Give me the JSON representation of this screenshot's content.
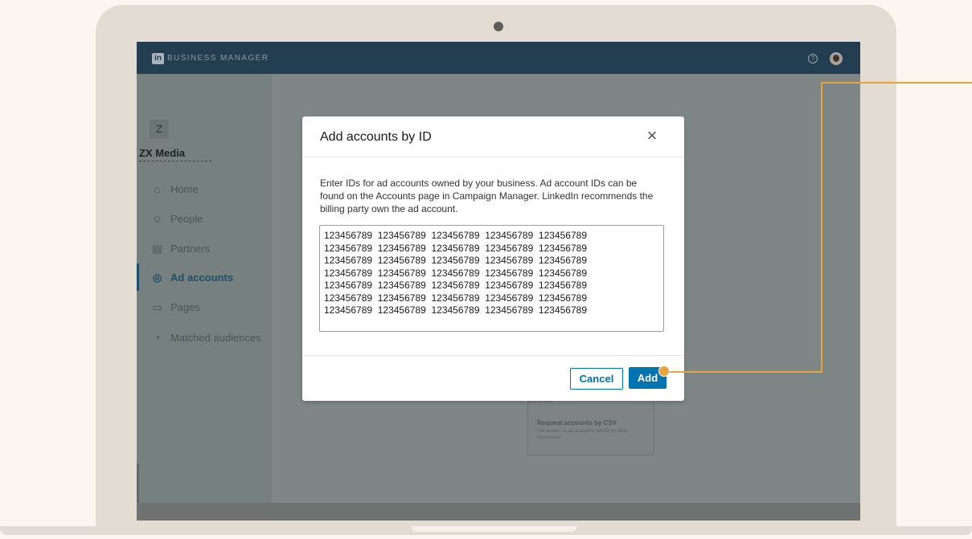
{
  "header": {
    "logo_text": "in",
    "brand": "BUSINESS MANAGER",
    "help_icon": "question-circle-icon",
    "avatar_icon": "user-avatar-icon"
  },
  "sidebar": {
    "org_initial": "Z",
    "org_name": "ZX Media",
    "items": [
      {
        "label": "Home",
        "icon": "home-icon"
      },
      {
        "label": "People",
        "icon": "people-icon"
      },
      {
        "label": "Partners",
        "icon": "building-icon"
      },
      {
        "label": "Ad accounts",
        "icon": "target-icon",
        "active": true
      },
      {
        "label": "Pages",
        "icon": "page-icon"
      },
      {
        "label": "Matched audiences",
        "icon": "audience-icon"
      }
    ]
  },
  "background_card": {
    "top_text": "ions in bulk",
    "title": "Request accounts by CSV",
    "description": "Get access to ad accounts owned by other businesses"
  },
  "modal": {
    "title": "Add accounts by ID",
    "close_icon": "close-icon",
    "description": "Enter IDs for ad accounts owned by your business. Ad account IDs can be found on the Accounts page in Campaign Manager. LinkedIn recommends the billing party own the ad account.",
    "ids_value": "123456789  123456789  123456789  123456789  123456789\n123456789  123456789  123456789  123456789  123456789\n123456789  123456789  123456789  123456789  123456789\n123456789  123456789  123456789  123456789  123456789\n123456789  123456789  123456789  123456789  123456789\n123456789  123456789  123456789  123456789  123456789\n123456789  123456789  123456789  123456789  123456789",
    "cancel_label": "Cancel",
    "add_label": "Add"
  },
  "colors": {
    "primary": "#0073b1",
    "header_bg": "#243e51",
    "callout": "#e8a33d",
    "laptop_frame": "#e3dcd2"
  }
}
